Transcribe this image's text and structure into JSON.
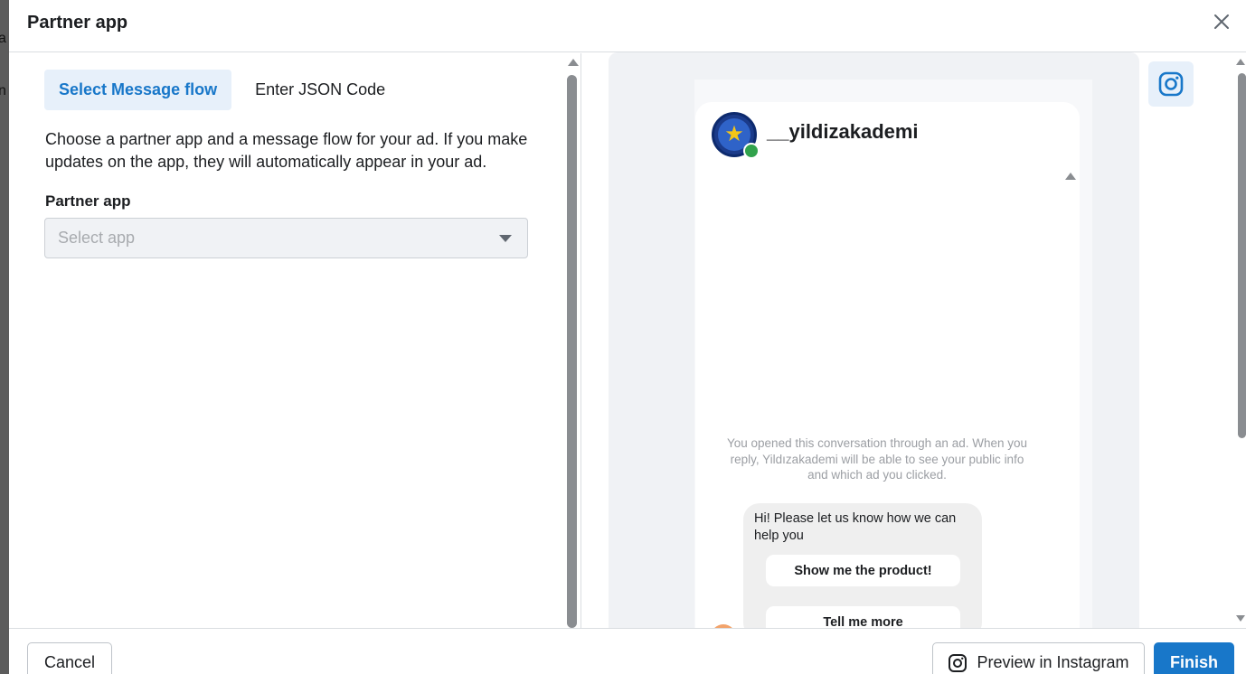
{
  "backdrop": {
    "fragments": [
      "a",
      "n"
    ]
  },
  "dialog": {
    "title": "Partner app"
  },
  "tabs": [
    {
      "label": "Select Message flow",
      "active": true
    },
    {
      "label": "Enter JSON Code",
      "active": false
    }
  ],
  "left": {
    "description": "Choose a partner app and a message flow for your ad. If you make updates on the app, they will automatically appear in your ad.",
    "field_label": "Partner app",
    "select_placeholder": "Select app"
  },
  "preview": {
    "username": "__yildizakademi",
    "notice": "You opened this conversation through an ad. When you reply, Yildızakademi will be able to see your public info and which ad you clicked.",
    "message": "Hi! Please let us know how we can help you",
    "quick_replies": [
      "Show me the product!",
      "Tell me more"
    ]
  },
  "footer": {
    "cancel_label": "Cancel",
    "preview_label": "Preview in Instagram",
    "finish_label": "Finish"
  },
  "icons": {
    "close": "close-icon",
    "instagram": "instagram-icon",
    "dropdown": "chevron-down-icon",
    "avatar": "star-avatar"
  },
  "colors": {
    "accent": "#1877c9",
    "active_tab_bg": "#e7f0fa",
    "online": "#31a24c"
  }
}
